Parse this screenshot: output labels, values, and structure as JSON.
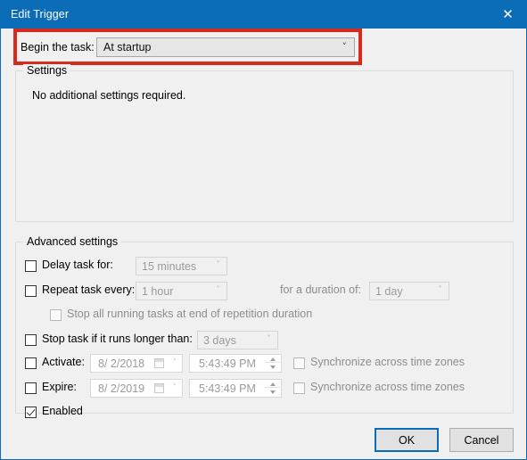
{
  "window": {
    "title": "Edit Trigger",
    "close_icon": "close-icon",
    "accent_color": "#0b6cb8",
    "highlight_color": "#d52b1e"
  },
  "begin_task": {
    "label": "Begin the task:",
    "value": "At startup",
    "arrow_icon": "chevron-down-icon"
  },
  "settings": {
    "legend": "Settings",
    "text": "No additional settings required."
  },
  "advanced": {
    "legend": "Advanced settings",
    "delay": {
      "label": "Delay task for:",
      "checked": false,
      "value": "15 minutes"
    },
    "repeat": {
      "label": "Repeat task every:",
      "checked": false,
      "value": "1 hour"
    },
    "duration": {
      "label": "for a duration of:",
      "value": "1 day"
    },
    "stop_all": {
      "label": "Stop all running tasks at end of repetition duration",
      "checked": false
    },
    "stop_task": {
      "label": "Stop task if it runs longer than:",
      "checked": false,
      "value": "3 days"
    },
    "activate": {
      "label": "Activate:",
      "checked": false,
      "date": "8/  2/2018",
      "time": "5:43:49 PM",
      "sync_label": "Synchronize across time zones",
      "sync_checked": false
    },
    "expire": {
      "label": "Expire:",
      "checked": false,
      "date": "8/  2/2019",
      "time": "5:43:49 PM",
      "sync_label": "Synchronize across time zones",
      "sync_checked": false
    },
    "enabled": {
      "label": "Enabled",
      "checked": true
    }
  },
  "buttons": {
    "ok": "OK",
    "cancel": "Cancel"
  }
}
